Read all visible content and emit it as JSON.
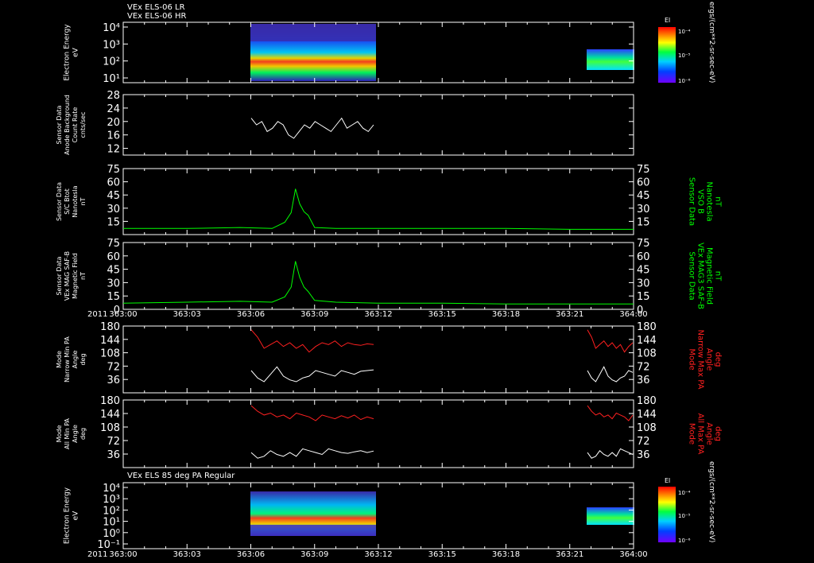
{
  "colors": {
    "background": "#000000",
    "axis": "#ffffff",
    "green": "#00ff00",
    "red": "#ff2020",
    "white": "#ffffff"
  },
  "header": {
    "line1": "VEx ELS-06 LR",
    "line2": "VEx ELS-06 HR"
  },
  "colorbar": {
    "title": "El",
    "units": "ergs/(cm**2-sr-sec-eV)",
    "top_tick": "10⁻⁴",
    "mid_tick": "10⁻⁵",
    "bottom_tick": "10⁻⁶"
  },
  "time_axis": {
    "year": "2011",
    "ticks": [
      "363:00",
      "363:03",
      "363:06",
      "363:09",
      "363:12",
      "363:15",
      "363:18",
      "363:21",
      "364:00"
    ]
  },
  "chart_data": [
    {
      "type": "heatmap",
      "panel": "els-lr-hr",
      "ylabel": [
        "Electron Energy",
        "eV"
      ],
      "yscale": "log",
      "ytick_labels": [
        "10⁴",
        "10³",
        "10²",
        "10¹"
      ],
      "data_intervals": [
        [
          "363:06",
          "363:11.7"
        ],
        [
          "363:21.2",
          "363:23.0"
        ]
      ]
    },
    {
      "type": "line",
      "panel": "background",
      "ylabel": [
        "Sensor Data",
        "Anode Background",
        "Count Rate",
        "cnts/sec"
      ],
      "ylim": [
        10,
        28
      ],
      "ytick_labels": [
        "28",
        "24",
        "20",
        "16",
        "12"
      ],
      "series": [
        {
          "x_range": [
            "363:06",
            "363:11.7"
          ],
          "values": [
            21,
            19,
            20,
            17,
            18,
            20,
            19,
            16,
            15,
            17,
            19,
            18,
            20,
            19,
            18,
            17,
            19,
            21,
            18,
            19,
            20,
            18,
            17,
            19
          ]
        }
      ]
    },
    {
      "type": "line",
      "panel": "bmag",
      "ylabel": [
        "Sensor Data",
        "S/C Btot",
        "Nanotesla",
        "nT"
      ],
      "ylabel_right": [
        "Sensor Data",
        "VSO B",
        "Nanotesla",
        "nT"
      ],
      "ylim": [
        0,
        75
      ],
      "ytick_labels": [
        "75",
        "60",
        "45",
        "30",
        "15"
      ],
      "series": [
        {
          "x": [
            0,
            3,
            5.5,
            7,
            7.6,
            7.9,
            8.1,
            8.3,
            8.5,
            8.7,
            9,
            10,
            12,
            15,
            18,
            21,
            24
          ],
          "values": [
            7,
            7,
            8,
            7,
            14,
            25,
            52,
            35,
            26,
            22,
            8,
            7,
            7,
            7,
            7,
            6,
            6
          ]
        }
      ]
    },
    {
      "type": "line",
      "panel": "vex-mag",
      "ylabel": [
        "Sensor Data",
        "VEx MAG SAF-B",
        "Magnetic Field",
        "nT"
      ],
      "ylabel_right": [
        "Sensor Data",
        "VEx MAG3 SAF-B",
        "Magnetic Field",
        "nT"
      ],
      "ylim": [
        0,
        75
      ],
      "ytick_labels": [
        "75",
        "60",
        "45",
        "30",
        "15",
        "0"
      ],
      "series": [
        {
          "x": [
            0,
            3,
            5.5,
            7,
            7.6,
            7.9,
            8.1,
            8.3,
            8.5,
            8.7,
            9,
            10,
            12,
            15,
            18,
            21,
            24
          ],
          "values": [
            7,
            8,
            9,
            8,
            14,
            25,
            54,
            36,
            25,
            20,
            10,
            8,
            7,
            7,
            6,
            6,
            6
          ]
        }
      ]
    },
    {
      "type": "line",
      "panel": "narrow-pa",
      "ylabel": [
        "Mode",
        "Narrow Min PA",
        "Angle",
        "deg"
      ],
      "ylabel_right": [
        "Mode",
        "Narrow Max PA",
        "Angle",
        "deg"
      ],
      "ylim": [
        0,
        180
      ],
      "ytick_labels": [
        "180",
        "144",
        "108",
        "72",
        "36"
      ],
      "series": [
        {
          "name_right": "max",
          "x_range": [
            "363:06",
            "363:11.7"
          ],
          "values": [
            170,
            150,
            120,
            130,
            140,
            125,
            135,
            120,
            130,
            110,
            125,
            135,
            130,
            140,
            125,
            135,
            130,
            128,
            132,
            130
          ]
        },
        {
          "name_right": "min",
          "x_range": [
            "363:06",
            "363:11.7"
          ],
          "values": [
            60,
            40,
            30,
            50,
            70,
            45,
            35,
            30,
            40,
            45,
            60,
            55,
            50,
            45,
            60,
            55,
            50,
            58,
            60,
            62
          ]
        }
      ]
    },
    {
      "type": "line",
      "panel": "all-pa",
      "ylabel": [
        "Mode",
        "All Min PA",
        "Angle",
        "deg"
      ],
      "ylabel_right": [
        "Mode",
        "All Max PA",
        "Angle",
        "deg"
      ],
      "ylim": [
        0,
        180
      ],
      "ytick_labels": [
        "180",
        "144",
        "108",
        "72",
        "36"
      ],
      "series": [
        {
          "name_right": "max",
          "x_range": [
            "363:06",
            "363:11.7"
          ],
          "values": [
            165,
            150,
            140,
            145,
            135,
            140,
            130,
            145,
            140,
            135,
            125,
            140,
            135,
            130,
            138,
            132,
            140,
            128,
            135,
            130
          ]
        },
        {
          "name_right": "min",
          "x_range": [
            "363:06",
            "363:11.7"
          ],
          "values": [
            40,
            25,
            30,
            45,
            35,
            30,
            40,
            30,
            50,
            45,
            40,
            35,
            50,
            45,
            40,
            38,
            42,
            45,
            40,
            44
          ]
        }
      ]
    },
    {
      "type": "heatmap",
      "panel": "els-85deg",
      "title": "VEx ELS 85 deg PA Regular",
      "ylabel": [
        "Electron Energy",
        "eV"
      ],
      "yscale": "log",
      "ytick_labels": [
        "10⁴",
        "10³",
        "10²",
        "10¹",
        "10⁰",
        "10⁻¹"
      ],
      "data_intervals": [
        [
          "363:06",
          "363:11.7"
        ],
        [
          "363:21.2",
          "363:23.0"
        ]
      ]
    }
  ]
}
